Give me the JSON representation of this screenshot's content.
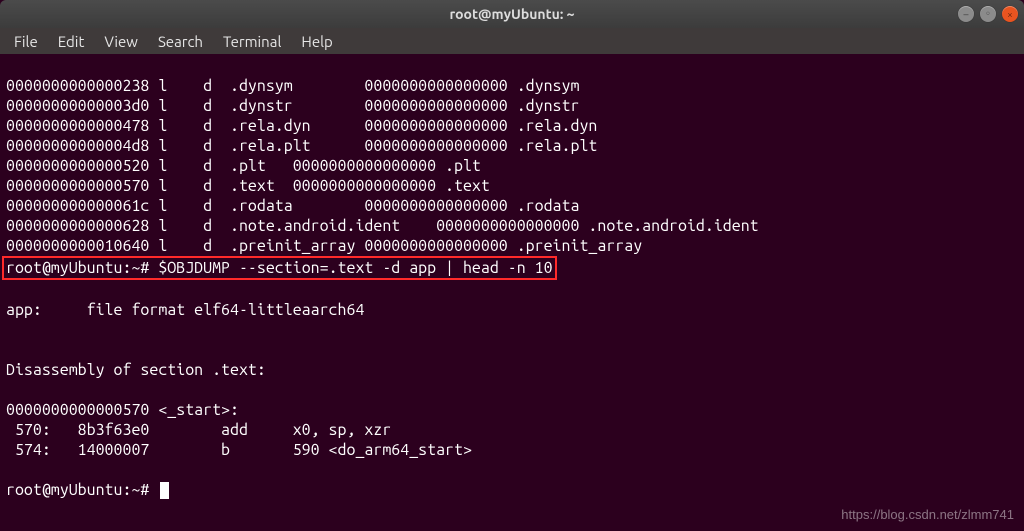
{
  "window": {
    "title": "root@myUbuntu: ~"
  },
  "menu": {
    "items": [
      "File",
      "Edit",
      "View",
      "Search",
      "Terminal",
      "Help"
    ]
  },
  "terminal": {
    "symbol_lines": [
      "0000000000000238 l    d  .dynsym        0000000000000000 .dynsym",
      "00000000000003d0 l    d  .dynstr        0000000000000000 .dynstr",
      "0000000000000478 l    d  .rela.dyn      0000000000000000 .rela.dyn",
      "00000000000004d8 l    d  .rela.plt      0000000000000000 .rela.plt",
      "0000000000000520 l    d  .plt   0000000000000000 .plt",
      "0000000000000570 l    d  .text  0000000000000000 .text",
      "000000000000061c l    d  .rodata        0000000000000000 .rodata",
      "0000000000000628 l    d  .note.android.ident    0000000000000000 .note.android.ident",
      "0000000000010640 l    d  .preinit_array 0000000000000000 .preinit_array"
    ],
    "prompt1": "root@myUbuntu:~# ",
    "command1": "$OBJDUMP --section=.text -d app | head -n 10",
    "blank": "",
    "file_format": "app:     file format elf64-littleaarch64",
    "disasm_header": "Disassembly of section .text:",
    "start_label": "0000000000000570 <_start>:",
    "insn1": " 570:   8b3f63e0        add     x0, sp, xzr",
    "insn2": " 574:   14000007        b       590 <do_arm64_start>",
    "prompt2": "root@myUbuntu:~# "
  },
  "watermark": "https://blog.csdn.net/zlmm741"
}
